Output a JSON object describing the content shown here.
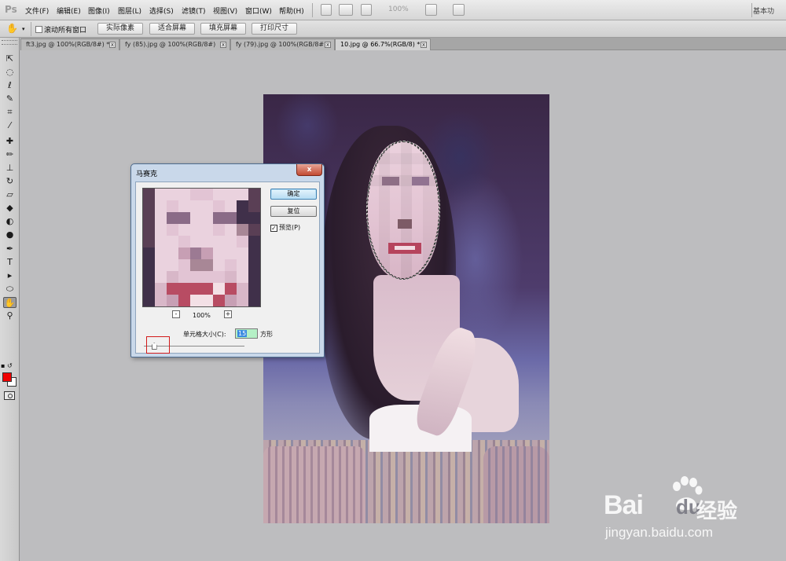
{
  "app": {
    "logo": "Ps",
    "workspace": "基本功"
  },
  "menu": [
    "文件(F)",
    "编辑(E)",
    "图像(I)",
    "图层(L)",
    "选择(S)",
    "滤镜(T)",
    "视图(V)",
    "窗口(W)",
    "帮助(H)"
  ],
  "menubar": {
    "zoom": "100%"
  },
  "options": {
    "scroll_all": "滚动所有窗口",
    "buttons": [
      "实际像素",
      "适合屏幕",
      "填充屏幕",
      "打印尺寸"
    ]
  },
  "tabs": [
    {
      "label": "ft3.jpg @ 100%(RGB/8#) *",
      "active": false
    },
    {
      "label": "fy (85).jpg @ 100%(RGB/8#)",
      "active": false
    },
    {
      "label": "fy (79).jpg @ 100%(RGB/8#)",
      "active": false
    },
    {
      "label": "10.jpg @ 66.7%(RGB/8) *",
      "active": true
    }
  ],
  "tools": [
    "move-tool",
    "marquee-tool",
    "lasso-tool",
    "quick-selection-tool",
    "crop-tool",
    "eyedropper-tool",
    "spot-healing-tool",
    "brush-tool",
    "clone-stamp-tool",
    "history-brush-tool",
    "eraser-tool",
    "paint-bucket-tool",
    "blur-tool",
    "dodge-tool",
    "pen-tool",
    "type-tool",
    "path-selection-tool",
    "ellipse-tool",
    "hand-tool",
    "zoom-tool"
  ],
  "colors": {
    "foreground": "#f00000",
    "background": "#ffffff"
  },
  "dialog": {
    "title": "马赛克",
    "close": "x",
    "ok": "确定",
    "reset": "复位",
    "preview_checkbox": "预览(P)",
    "preview_checked": true,
    "preview_zoom": "100%",
    "zoom_out": "-",
    "zoom_in": "+",
    "cell_size_label": "单元格大小(C):",
    "cell_size_value": "15",
    "cell_size_unit": "方形",
    "slider_level": 0.06
  },
  "watermark": {
    "brand": "Bai",
    "brand2": "du",
    "cn": "经验",
    "url": "jingyan.baidu.com"
  }
}
